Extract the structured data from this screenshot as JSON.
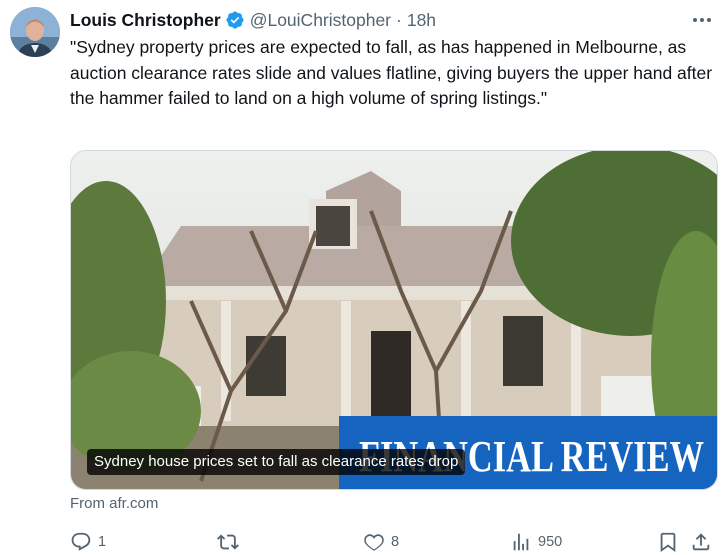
{
  "tweet": {
    "author_name": "Louis Christopher",
    "handle": "@LouiChristopher",
    "separator": "·",
    "time": "18h",
    "text": "\"Sydney property prices are expected to fall, as has happened in Melbourne, as auction clearance rates slide and values flatline, giving buyers the upper hand after the hammer failed to land on a high volume of spring listings.\""
  },
  "card": {
    "headline": "Sydney house prices set to fall as clearance rates drop",
    "banner_text": "FINANCIAL REVIEW",
    "source": "From afr.com"
  },
  "actions": {
    "replies": "1",
    "retweets": "",
    "likes": "8",
    "views": "950"
  },
  "colors": {
    "verified": "#1d9bf0",
    "secondary_text": "#536471",
    "banner": "#1565c0"
  },
  "icons": [
    "verified-badge-icon",
    "more-icon",
    "reply-icon",
    "retweet-icon",
    "like-icon",
    "views-icon",
    "bookmark-icon",
    "share-icon"
  ]
}
